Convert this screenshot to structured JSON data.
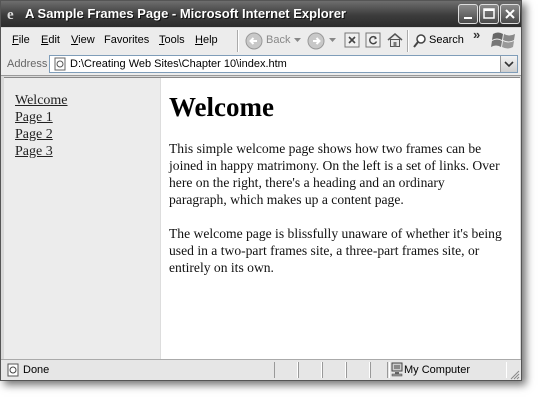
{
  "window": {
    "title": "A Sample Frames Page - Microsoft Internet Explorer"
  },
  "menu": [
    {
      "label": "File",
      "key": "F",
      "rest": "ile"
    },
    {
      "label": "Edit",
      "key": "E",
      "rest": "dit"
    },
    {
      "label": "View",
      "key": "V",
      "rest": "iew"
    },
    {
      "label": "Favorites",
      "key": "",
      "rest": "Favorites"
    },
    {
      "label": "Tools",
      "key": "T",
      "rest": "ools"
    },
    {
      "label": "Help",
      "key": "H",
      "rest": "elp"
    }
  ],
  "toolbar": {
    "back_label": "Back",
    "search_label": "Search",
    "more_label": "»"
  },
  "address": {
    "label": "Address",
    "url": "D:\\Creating Web Sites\\Chapter 10\\index.htm"
  },
  "left_frame": {
    "links": [
      "Welcome",
      "Page 1",
      "Page 2",
      "Page 3"
    ]
  },
  "right_frame": {
    "heading": "Welcome",
    "paragraph1": "This simple welcome page shows how two frames can be joined in happy matrimony. On the left is a set of links. Over here on the right, there's a heading and an ordinary paragraph, which makes up a content page.",
    "paragraph2": "The welcome page is blissfully unaware of whether it's being used in a two-part frames site, a three-part frames site, or entirely on its own."
  },
  "status": {
    "text": "Done",
    "zone": "My Computer"
  },
  "colors": {
    "titlebar": "#3c3c3c",
    "left_frame_bg": "#ececec",
    "content_bg": "#ffffff"
  }
}
